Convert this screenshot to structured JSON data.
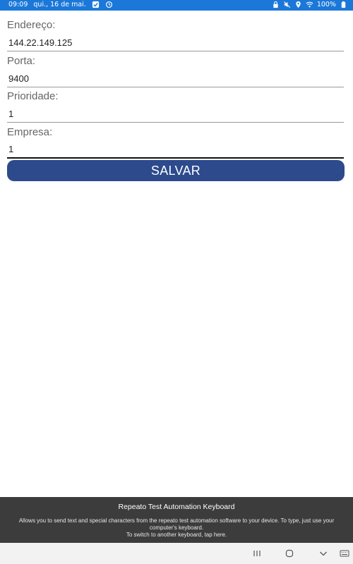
{
  "status_bar": {
    "time": "09:09",
    "date": "qui., 16 de mai.",
    "battery": "100%",
    "icons_left": [
      "check-square-icon",
      "sync-icon"
    ],
    "icons_right": [
      "lock-icon",
      "mute-icon",
      "location-icon",
      "wifi-icon",
      "battery-icon"
    ]
  },
  "form": {
    "endereco": {
      "label": "Endereço:",
      "value": "144.22.149.125"
    },
    "porta": {
      "label": "Porta:",
      "value": "9400"
    },
    "prioridade": {
      "label": "Prioridade:",
      "value": "1"
    },
    "empresa": {
      "label": "Empresa:",
      "value": "1"
    }
  },
  "save_button_label": "SALVAR",
  "colors": {
    "status_bar": "#1b78d9",
    "button": "#2c4a8c",
    "keyboard_panel": "#3c3c3c",
    "nav_bar": "#f2f2f2"
  },
  "keyboard": {
    "title": "Repeato Test Automation Keyboard",
    "description": "Allows you to send text and special characters from the repeato test automation software to your device. To type, just use your computer's keyboard.",
    "hint": "To switch to another keyboard, tap here."
  },
  "nav_bar": {
    "buttons": [
      "recents-icon",
      "home-icon",
      "back-icon",
      "keyboard-switch-icon"
    ]
  }
}
